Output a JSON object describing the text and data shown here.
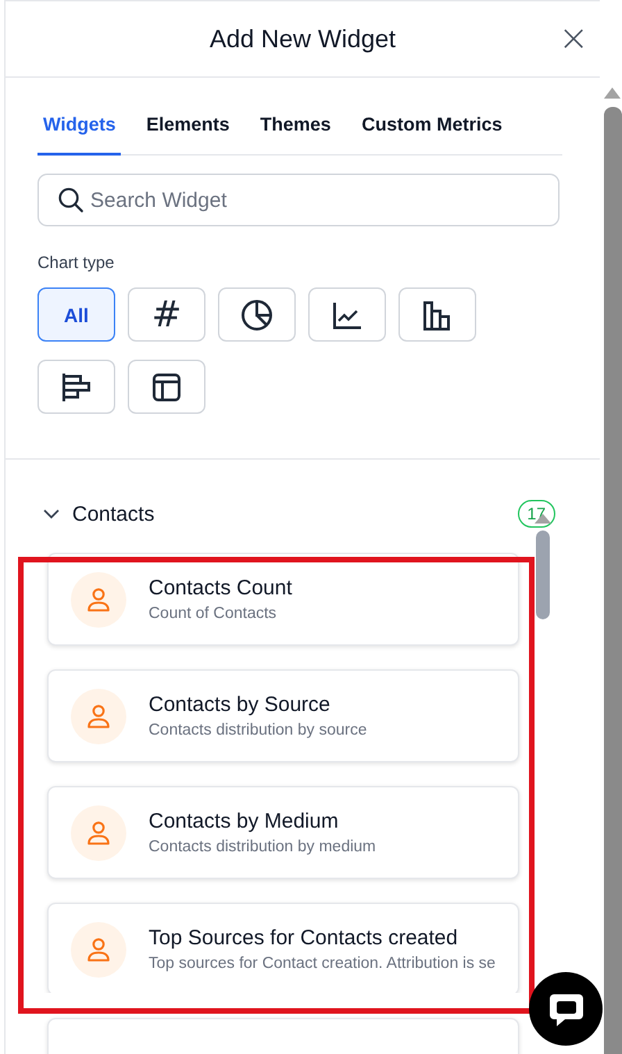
{
  "dialog": {
    "title": "Add New Widget",
    "close": "×"
  },
  "tabs": [
    {
      "label": "Widgets",
      "selected": true
    },
    {
      "label": "Elements",
      "selected": false
    },
    {
      "label": "Themes",
      "selected": false
    },
    {
      "label": "Custom Metrics",
      "selected": false
    }
  ],
  "search": {
    "placeholder": "Search Widget"
  },
  "chart_type": {
    "label": "Chart type",
    "options": [
      {
        "kind": "all",
        "label": "All",
        "selected": true
      },
      {
        "kind": "number",
        "label": "#",
        "selected": false
      },
      {
        "kind": "pie",
        "selected": false
      },
      {
        "kind": "line",
        "selected": false
      },
      {
        "kind": "bar",
        "selected": false
      },
      {
        "kind": "hbar",
        "selected": false
      },
      {
        "kind": "table",
        "selected": false
      }
    ]
  },
  "section": {
    "title": "Contacts",
    "expanded": true,
    "count": "17",
    "widgets": [
      {
        "title": "Contacts Count",
        "description": "Count of Contacts"
      },
      {
        "title": "Contacts by Source",
        "description": "Contacts distribution by source"
      },
      {
        "title": "Contacts by Medium",
        "description": "Contacts distribution by medium"
      },
      {
        "title": "Top Sources for Contacts created",
        "description": "Top sources for Contact creation. Attribution is se"
      }
    ]
  }
}
